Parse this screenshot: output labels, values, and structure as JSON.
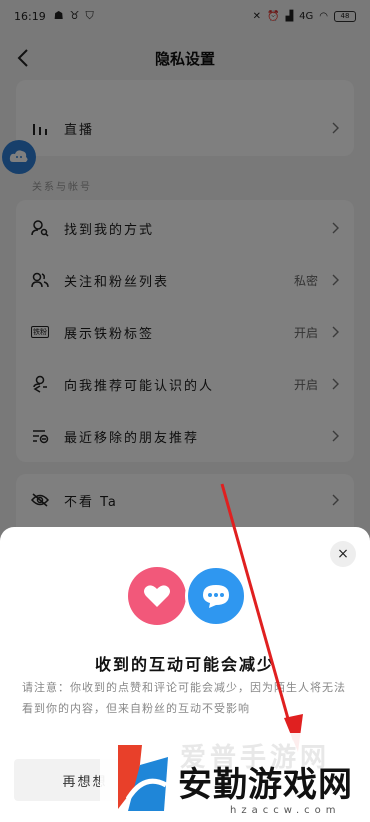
{
  "status": {
    "time": "16:19",
    "network": "4G",
    "battery": "48"
  },
  "header": {
    "title": "隐私设置"
  },
  "first_card": {
    "item_live": "直播"
  },
  "section": {
    "relations": "关系与帐号"
  },
  "relations": [
    {
      "label": "找到我的方式",
      "value": "",
      "icon": "search-user-icon"
    },
    {
      "label": "关注和粉丝列表",
      "value": "私密",
      "icon": "users-icon"
    },
    {
      "label": "展示铁粉标签",
      "value": "开启",
      "icon": "fan-badge-icon"
    },
    {
      "label": "向我推荐可能认识的人",
      "value": "开启",
      "icon": "recommend-user-icon"
    },
    {
      "label": "最近移除的朋友推荐",
      "value": "",
      "icon": "removed-friends-icon"
    }
  ],
  "last_card": {
    "item_hide": "不看 Ta"
  },
  "badge_text": "铁粉",
  "sheet": {
    "title": "收到的互动可能会减少",
    "body": "请注意：你收到的点赞和评论可能会减少，因为陌生人将无法看到你的内容，但来自粉丝的互动不受影响",
    "button": "再想想",
    "close": "×"
  },
  "watermark": {
    "brand": "安勤游戏网",
    "top": "爱普手游网",
    "url": "hzaccw.com"
  },
  "colors": {
    "heart": "#f2587a",
    "chat": "#2f97f0",
    "arrow": "#e02020"
  }
}
